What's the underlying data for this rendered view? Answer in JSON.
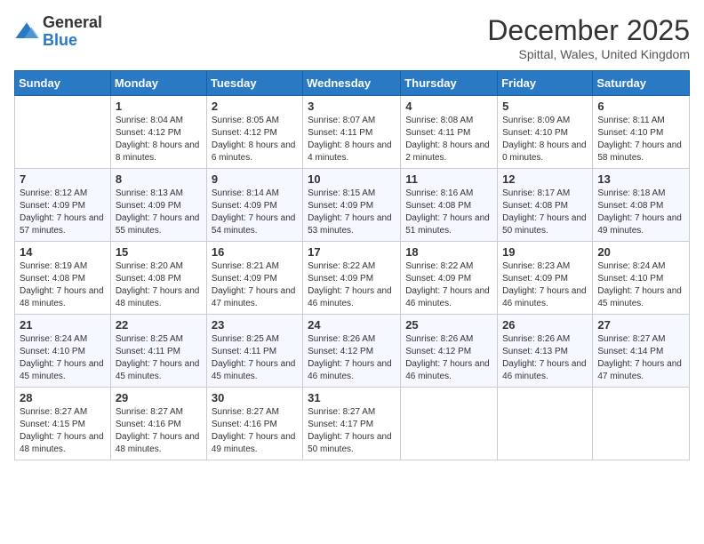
{
  "logo": {
    "general": "General",
    "blue": "Blue"
  },
  "title": "December 2025",
  "location": "Spittal, Wales, United Kingdom",
  "headers": [
    "Sunday",
    "Monday",
    "Tuesday",
    "Wednesday",
    "Thursday",
    "Friday",
    "Saturday"
  ],
  "weeks": [
    [
      {
        "day": "",
        "sunrise": "",
        "sunset": "",
        "daylight": ""
      },
      {
        "day": "1",
        "sunrise": "Sunrise: 8:04 AM",
        "sunset": "Sunset: 4:12 PM",
        "daylight": "Daylight: 8 hours and 8 minutes."
      },
      {
        "day": "2",
        "sunrise": "Sunrise: 8:05 AM",
        "sunset": "Sunset: 4:12 PM",
        "daylight": "Daylight: 8 hours and 6 minutes."
      },
      {
        "day": "3",
        "sunrise": "Sunrise: 8:07 AM",
        "sunset": "Sunset: 4:11 PM",
        "daylight": "Daylight: 8 hours and 4 minutes."
      },
      {
        "day": "4",
        "sunrise": "Sunrise: 8:08 AM",
        "sunset": "Sunset: 4:11 PM",
        "daylight": "Daylight: 8 hours and 2 minutes."
      },
      {
        "day": "5",
        "sunrise": "Sunrise: 8:09 AM",
        "sunset": "Sunset: 4:10 PM",
        "daylight": "Daylight: 8 hours and 0 minutes."
      },
      {
        "day": "6",
        "sunrise": "Sunrise: 8:11 AM",
        "sunset": "Sunset: 4:10 PM",
        "daylight": "Daylight: 7 hours and 58 minutes."
      }
    ],
    [
      {
        "day": "7",
        "sunrise": "Sunrise: 8:12 AM",
        "sunset": "Sunset: 4:09 PM",
        "daylight": "Daylight: 7 hours and 57 minutes."
      },
      {
        "day": "8",
        "sunrise": "Sunrise: 8:13 AM",
        "sunset": "Sunset: 4:09 PM",
        "daylight": "Daylight: 7 hours and 55 minutes."
      },
      {
        "day": "9",
        "sunrise": "Sunrise: 8:14 AM",
        "sunset": "Sunset: 4:09 PM",
        "daylight": "Daylight: 7 hours and 54 minutes."
      },
      {
        "day": "10",
        "sunrise": "Sunrise: 8:15 AM",
        "sunset": "Sunset: 4:09 PM",
        "daylight": "Daylight: 7 hours and 53 minutes."
      },
      {
        "day": "11",
        "sunrise": "Sunrise: 8:16 AM",
        "sunset": "Sunset: 4:08 PM",
        "daylight": "Daylight: 7 hours and 51 minutes."
      },
      {
        "day": "12",
        "sunrise": "Sunrise: 8:17 AM",
        "sunset": "Sunset: 4:08 PM",
        "daylight": "Daylight: 7 hours and 50 minutes."
      },
      {
        "day": "13",
        "sunrise": "Sunrise: 8:18 AM",
        "sunset": "Sunset: 4:08 PM",
        "daylight": "Daylight: 7 hours and 49 minutes."
      }
    ],
    [
      {
        "day": "14",
        "sunrise": "Sunrise: 8:19 AM",
        "sunset": "Sunset: 4:08 PM",
        "daylight": "Daylight: 7 hours and 48 minutes."
      },
      {
        "day": "15",
        "sunrise": "Sunrise: 8:20 AM",
        "sunset": "Sunset: 4:08 PM",
        "daylight": "Daylight: 7 hours and 48 minutes."
      },
      {
        "day": "16",
        "sunrise": "Sunrise: 8:21 AM",
        "sunset": "Sunset: 4:09 PM",
        "daylight": "Daylight: 7 hours and 47 minutes."
      },
      {
        "day": "17",
        "sunrise": "Sunrise: 8:22 AM",
        "sunset": "Sunset: 4:09 PM",
        "daylight": "Daylight: 7 hours and 46 minutes."
      },
      {
        "day": "18",
        "sunrise": "Sunrise: 8:22 AM",
        "sunset": "Sunset: 4:09 PM",
        "daylight": "Daylight: 7 hours and 46 minutes."
      },
      {
        "day": "19",
        "sunrise": "Sunrise: 8:23 AM",
        "sunset": "Sunset: 4:09 PM",
        "daylight": "Daylight: 7 hours and 46 minutes."
      },
      {
        "day": "20",
        "sunrise": "Sunrise: 8:24 AM",
        "sunset": "Sunset: 4:10 PM",
        "daylight": "Daylight: 7 hours and 45 minutes."
      }
    ],
    [
      {
        "day": "21",
        "sunrise": "Sunrise: 8:24 AM",
        "sunset": "Sunset: 4:10 PM",
        "daylight": "Daylight: 7 hours and 45 minutes."
      },
      {
        "day": "22",
        "sunrise": "Sunrise: 8:25 AM",
        "sunset": "Sunset: 4:11 PM",
        "daylight": "Daylight: 7 hours and 45 minutes."
      },
      {
        "day": "23",
        "sunrise": "Sunrise: 8:25 AM",
        "sunset": "Sunset: 4:11 PM",
        "daylight": "Daylight: 7 hours and 45 minutes."
      },
      {
        "day": "24",
        "sunrise": "Sunrise: 8:26 AM",
        "sunset": "Sunset: 4:12 PM",
        "daylight": "Daylight: 7 hours and 46 minutes."
      },
      {
        "day": "25",
        "sunrise": "Sunrise: 8:26 AM",
        "sunset": "Sunset: 4:12 PM",
        "daylight": "Daylight: 7 hours and 46 minutes."
      },
      {
        "day": "26",
        "sunrise": "Sunrise: 8:26 AM",
        "sunset": "Sunset: 4:13 PM",
        "daylight": "Daylight: 7 hours and 46 minutes."
      },
      {
        "day": "27",
        "sunrise": "Sunrise: 8:27 AM",
        "sunset": "Sunset: 4:14 PM",
        "daylight": "Daylight: 7 hours and 47 minutes."
      }
    ],
    [
      {
        "day": "28",
        "sunrise": "Sunrise: 8:27 AM",
        "sunset": "Sunset: 4:15 PM",
        "daylight": "Daylight: 7 hours and 48 minutes."
      },
      {
        "day": "29",
        "sunrise": "Sunrise: 8:27 AM",
        "sunset": "Sunset: 4:16 PM",
        "daylight": "Daylight: 7 hours and 48 minutes."
      },
      {
        "day": "30",
        "sunrise": "Sunrise: 8:27 AM",
        "sunset": "Sunset: 4:16 PM",
        "daylight": "Daylight: 7 hours and 49 minutes."
      },
      {
        "day": "31",
        "sunrise": "Sunrise: 8:27 AM",
        "sunset": "Sunset: 4:17 PM",
        "daylight": "Daylight: 7 hours and 50 minutes."
      },
      {
        "day": "",
        "sunrise": "",
        "sunset": "",
        "daylight": ""
      },
      {
        "day": "",
        "sunrise": "",
        "sunset": "",
        "daylight": ""
      },
      {
        "day": "",
        "sunrise": "",
        "sunset": "",
        "daylight": ""
      }
    ]
  ]
}
